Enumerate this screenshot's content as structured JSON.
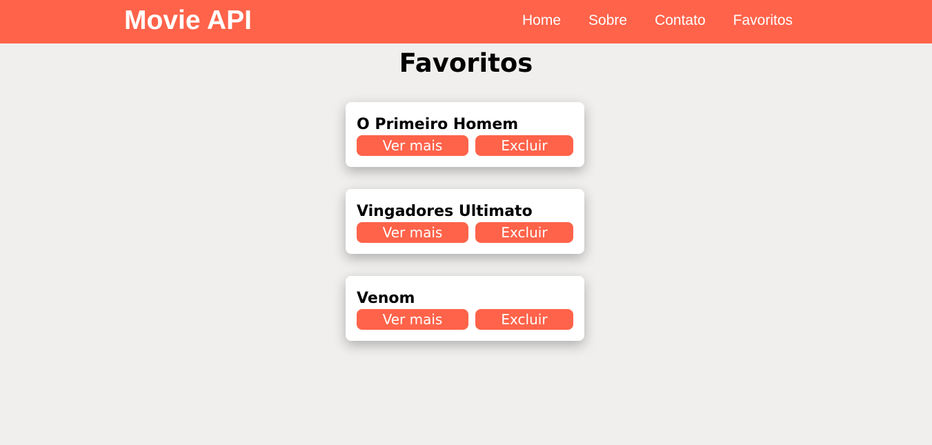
{
  "header": {
    "brand": "Movie API",
    "nav": [
      {
        "label": "Home"
      },
      {
        "label": "Sobre"
      },
      {
        "label": "Contato"
      },
      {
        "label": "Favoritos"
      }
    ]
  },
  "page": {
    "title": "Favoritos"
  },
  "favorites": [
    {
      "title": "O Primeiro Homem",
      "more_label": "Ver mais",
      "delete_label": "Excluir"
    },
    {
      "title": "Vingadores Ultimato",
      "more_label": "Ver mais",
      "delete_label": "Excluir"
    },
    {
      "title": "Venom",
      "more_label": "Ver mais",
      "delete_label": "Excluir"
    }
  ],
  "colors": {
    "accent": "#ff634a",
    "background": "#f0efed",
    "card": "#ffffff"
  }
}
